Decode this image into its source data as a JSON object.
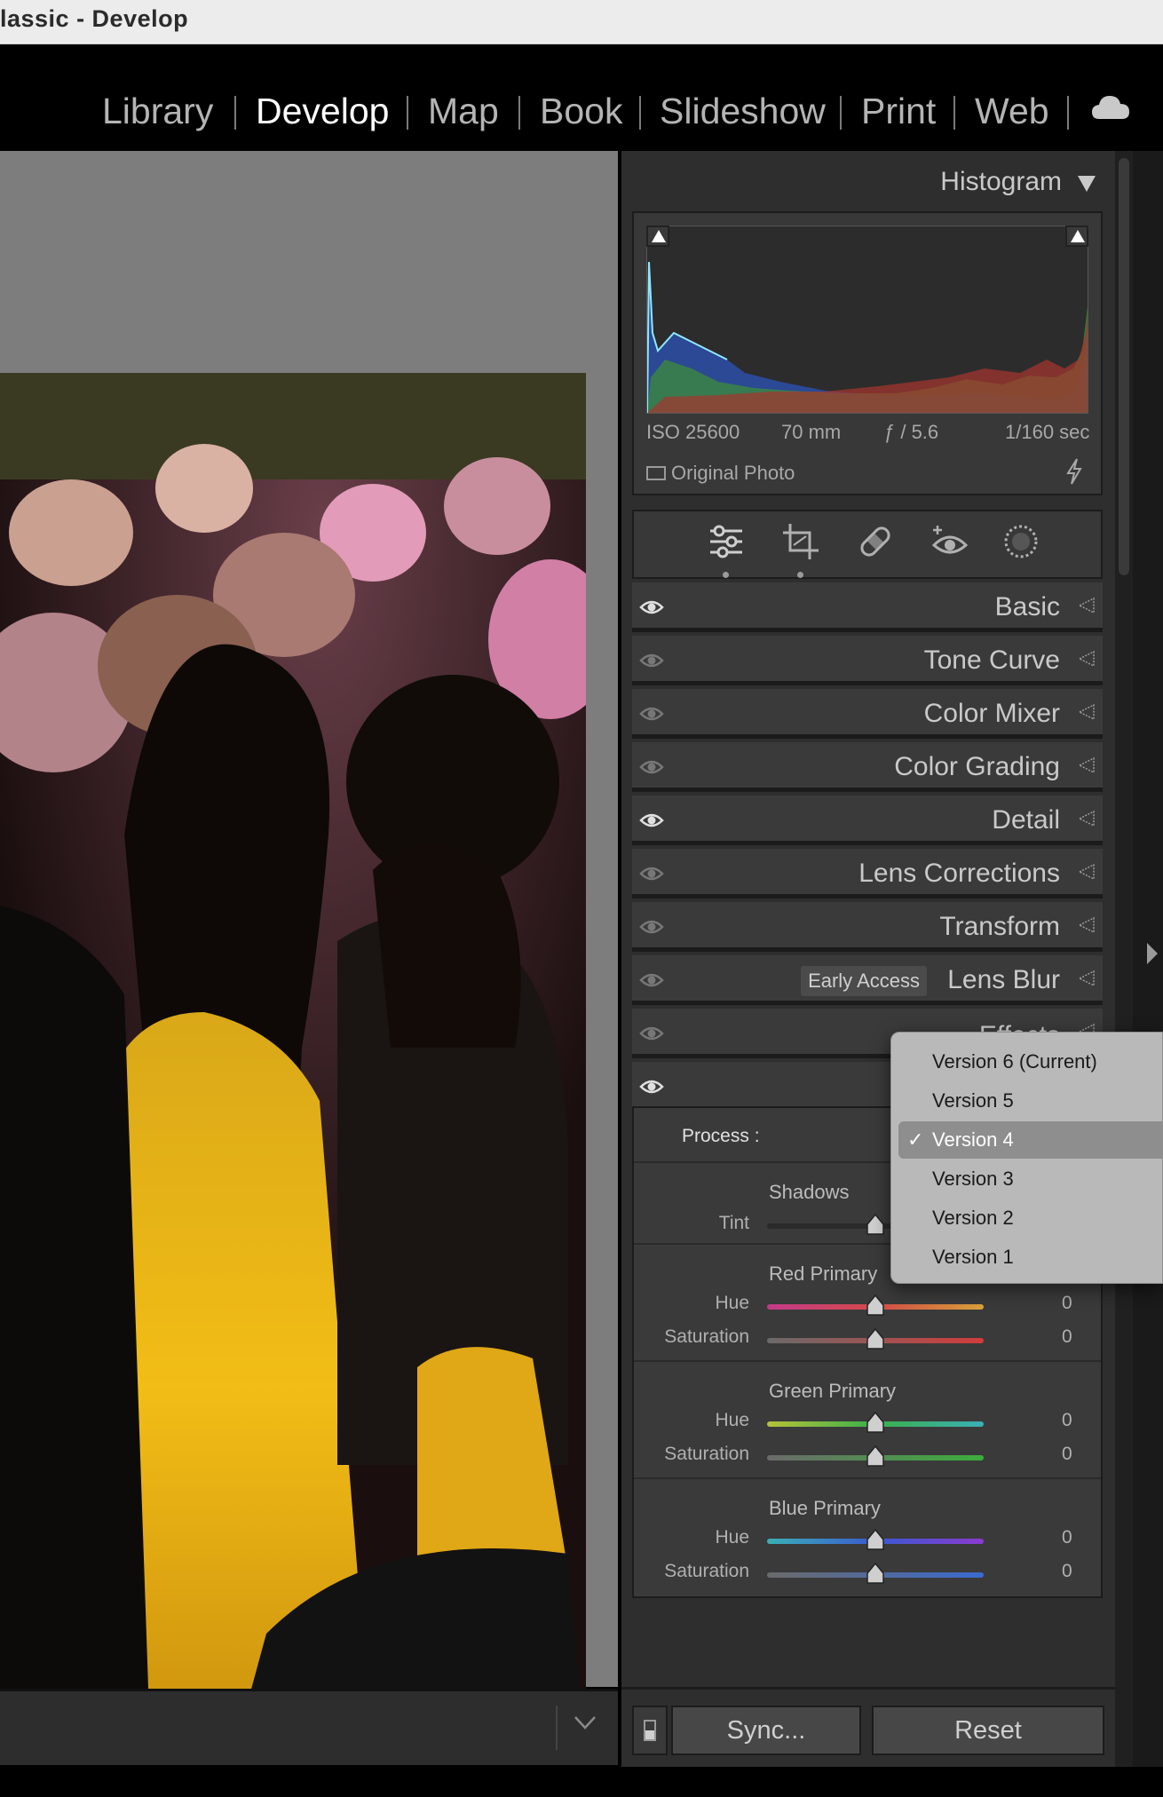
{
  "window": {
    "title": "lassic - Develop"
  },
  "modules": [
    "Library",
    "Develop",
    "Map",
    "Book",
    "Slideshow",
    "Print",
    "Web"
  ],
  "histogram": {
    "title": "Histogram",
    "iso": "ISO 25600",
    "focal": "70 mm",
    "aperture": "ƒ / 5.6",
    "shutter": "1/160 sec",
    "original_label": "Original Photo"
  },
  "sections": {
    "basic": "Basic",
    "tone_curve": "Tone Curve",
    "color_mixer": "Color Mixer",
    "color_grading": "Color Grading",
    "detail": "Detail",
    "lens_corrections": "Lens Corrections",
    "transform": "Transform",
    "lens_blur": "Lens Blur",
    "lens_blur_badge": "Early Access",
    "effects": "Effects"
  },
  "calibration": {
    "process_label": "Process :",
    "shadows": {
      "title": "Shadows",
      "tint_label": "Tint"
    },
    "red": {
      "title": "Red Primary",
      "hue_label": "Hue",
      "hue_value": "0",
      "sat_label": "Saturation",
      "sat_value": "0"
    },
    "green": {
      "title": "Green Primary",
      "hue_label": "Hue",
      "hue_value": "0",
      "sat_label": "Saturation",
      "sat_value": "0"
    },
    "blue": {
      "title": "Blue Primary",
      "hue_label": "Hue",
      "hue_value": "0",
      "sat_label": "Saturation",
      "sat_value": "0"
    }
  },
  "process_menu": {
    "items": [
      "Version 6 (Current)",
      "Version 5",
      "Version 4",
      "Version 3",
      "Version 2",
      "Version 1"
    ],
    "selected": "Version 4",
    "check": "✓"
  },
  "buttons": {
    "sync": "Sync...",
    "reset": "Reset"
  },
  "colors": {
    "panel": "#2e2e2e",
    "section": "#3a3a3a",
    "menu": "#b9b9b9",
    "menu_selected": "#8e8e8e"
  }
}
